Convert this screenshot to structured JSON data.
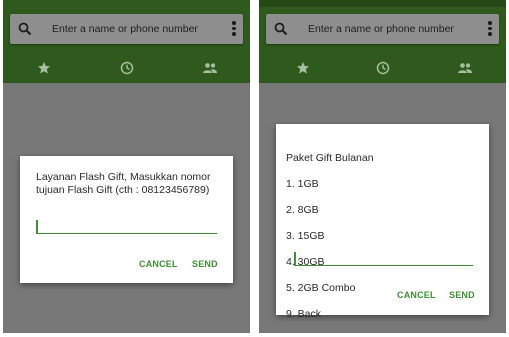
{
  "left_screen": {
    "search": {
      "placeholder": "Enter a name or phone number"
    },
    "tabs": [
      {
        "icon": "star-icon"
      },
      {
        "icon": "clock-icon"
      },
      {
        "icon": "contacts-icon"
      }
    ],
    "dialog": {
      "message": "Layanan Flash Gift, Masukkan nomor tujuan Flash Gift (cth : 08123456789)",
      "input_value": "",
      "cancel_label": "CANCEL",
      "send_label": "SEND"
    }
  },
  "right_screen": {
    "search": {
      "placeholder": "Enter a name or phone number"
    },
    "tabs": [
      {
        "icon": "star-icon"
      },
      {
        "icon": "clock-icon"
      },
      {
        "icon": "contacts-icon"
      }
    ],
    "dialog": {
      "title": "Paket Gift Bulanan",
      "options": [
        "1. 1GB",
        "2. 8GB",
        "3. 15GB",
        "4. 30GB",
        "5. 2GB Combo",
        "9. Back"
      ],
      "input_value": "",
      "cancel_label": "CANCEL",
      "send_label": "SEND"
    }
  },
  "colors": {
    "appbar": "#2e5a1d",
    "accent": "#3f8f35",
    "scrim": "#787878"
  }
}
